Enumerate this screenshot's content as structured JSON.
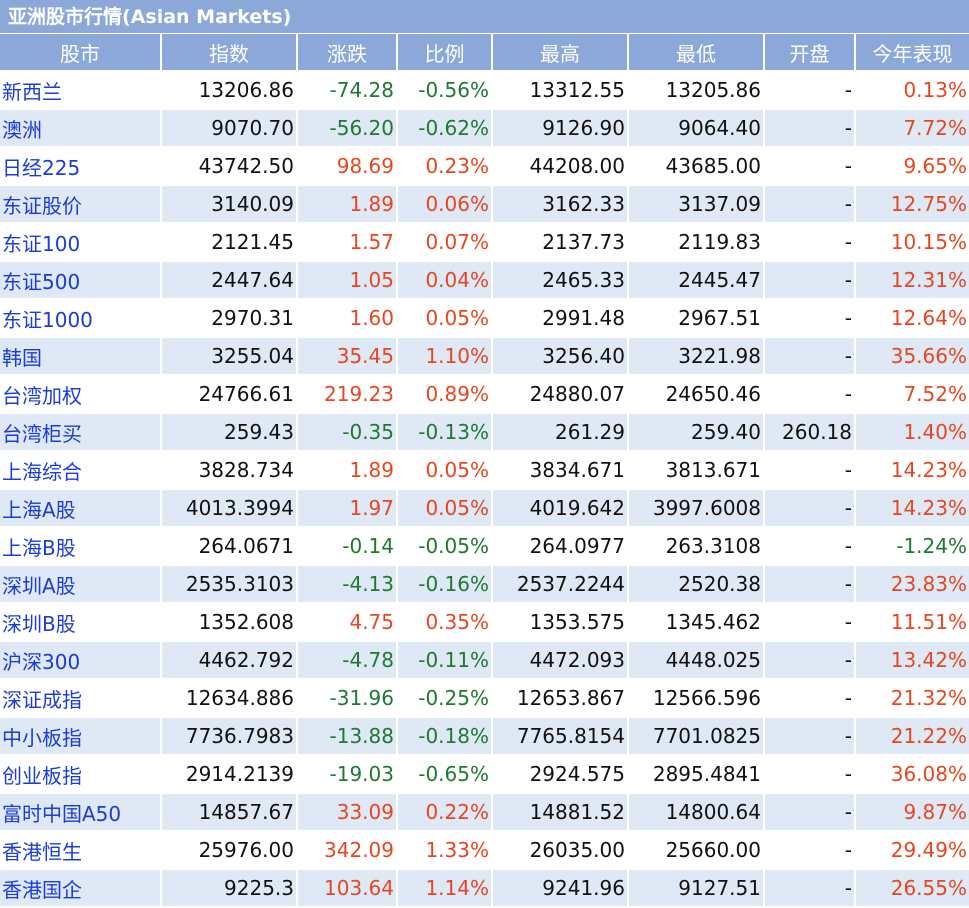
{
  "title": "亚洲股市行情(Asian Markets)",
  "headers": [
    "股市",
    "指数",
    "涨跌",
    "比例",
    "最高",
    "最低",
    "开盘",
    "今年表现"
  ],
  "rows": [
    {
      "name": "新西兰",
      "index": "13206.86",
      "change": "-74.28",
      "pct": "-0.56%",
      "high": "13312.55",
      "low": "13205.86",
      "open": "-",
      "ytd": "0.13%"
    },
    {
      "name": "澳洲",
      "index": "9070.70",
      "change": "-56.20",
      "pct": "-0.62%",
      "high": "9126.90",
      "low": "9064.40",
      "open": "-",
      "ytd": "7.72%"
    },
    {
      "name": "日经225",
      "index": "43742.50",
      "change": "98.69",
      "pct": "0.23%",
      "high": "44208.00",
      "low": "43685.00",
      "open": "-",
      "ytd": "9.65%"
    },
    {
      "name": "东证股价",
      "index": "3140.09",
      "change": "1.89",
      "pct": "0.06%",
      "high": "3162.33",
      "low": "3137.09",
      "open": "-",
      "ytd": "12.75%"
    },
    {
      "name": "东证100",
      "index": "2121.45",
      "change": "1.57",
      "pct": "0.07%",
      "high": "2137.73",
      "low": "2119.83",
      "open": "-",
      "ytd": "10.15%"
    },
    {
      "name": "东证500",
      "index": "2447.64",
      "change": "1.05",
      "pct": "0.04%",
      "high": "2465.33",
      "low": "2445.47",
      "open": "-",
      "ytd": "12.31%"
    },
    {
      "name": "东证1000",
      "index": "2970.31",
      "change": "1.60",
      "pct": "0.05%",
      "high": "2991.48",
      "low": "2967.51",
      "open": "-",
      "ytd": "12.64%"
    },
    {
      "name": "韩国",
      "index": "3255.04",
      "change": "35.45",
      "pct": "1.10%",
      "high": "3256.40",
      "low": "3221.98",
      "open": "-",
      "ytd": "35.66%"
    },
    {
      "name": "台湾加权",
      "index": "24766.61",
      "change": "219.23",
      "pct": "0.89%",
      "high": "24880.07",
      "low": "24650.46",
      "open": "-",
      "ytd": "7.52%"
    },
    {
      "name": "台湾柜买",
      "index": "259.43",
      "change": "-0.35",
      "pct": "-0.13%",
      "high": "261.29",
      "low": "259.40",
      "open": "260.18",
      "ytd": "1.40%"
    },
    {
      "name": "上海综合",
      "index": "3828.734",
      "change": "1.89",
      "pct": "0.05%",
      "high": "3834.671",
      "low": "3813.671",
      "open": "-",
      "ytd": "14.23%"
    },
    {
      "name": "上海A股",
      "index": "4013.3994",
      "change": "1.97",
      "pct": "0.05%",
      "high": "4019.642",
      "low": "3997.6008",
      "open": "-",
      "ytd": "14.23%"
    },
    {
      "name": "上海B股",
      "index": "264.0671",
      "change": "-0.14",
      "pct": "-0.05%",
      "high": "264.0977",
      "low": "263.3108",
      "open": "-",
      "ytd": "-1.24%"
    },
    {
      "name": "深圳A股",
      "index": "2535.3103",
      "change": "-4.13",
      "pct": "-0.16%",
      "high": "2537.2244",
      "low": "2520.38",
      "open": "-",
      "ytd": "23.83%"
    },
    {
      "name": "深圳B股",
      "index": "1352.608",
      "change": "4.75",
      "pct": "0.35%",
      "high": "1353.575",
      "low": "1345.462",
      "open": "-",
      "ytd": "11.51%"
    },
    {
      "name": "沪深300",
      "index": "4462.792",
      "change": "-4.78",
      "pct": "-0.11%",
      "high": "4472.093",
      "low": "4448.025",
      "open": "-",
      "ytd": "13.42%"
    },
    {
      "name": "深证成指",
      "index": "12634.886",
      "change": "-31.96",
      "pct": "-0.25%",
      "high": "12653.867",
      "low": "12566.596",
      "open": "-",
      "ytd": "21.32%"
    },
    {
      "name": "中小板指",
      "index": "7736.7983",
      "change": "-13.88",
      "pct": "-0.18%",
      "high": "7765.8154",
      "low": "7701.0825",
      "open": "-",
      "ytd": "21.22%"
    },
    {
      "name": "创业板指",
      "index": "2914.2139",
      "change": "-19.03",
      "pct": "-0.65%",
      "high": "2924.575",
      "low": "2895.4841",
      "open": "-",
      "ytd": "36.08%"
    },
    {
      "name": "富时中国A50",
      "index": "14857.67",
      "change": "33.09",
      "pct": "0.22%",
      "high": "14881.52",
      "low": "14800.64",
      "open": "-",
      "ytd": "9.87%"
    },
    {
      "name": "香港恒生",
      "index": "25976.00",
      "change": "342.09",
      "pct": "1.33%",
      "high": "26035.00",
      "low": "25660.00",
      "open": "-",
      "ytd": "29.49%"
    },
    {
      "name": "香港国企",
      "index": "9225.3",
      "change": "103.64",
      "pct": "1.14%",
      "high": "9241.96",
      "low": "9127.51",
      "open": "-",
      "ytd": "26.55%"
    }
  ],
  "colors": {
    "header_bg": "#8ba8d8",
    "row_alt_bg": "#dfe8f5",
    "up": "#e8461e",
    "down": "#1e7a2e",
    "name": "#1a3cd8"
  }
}
